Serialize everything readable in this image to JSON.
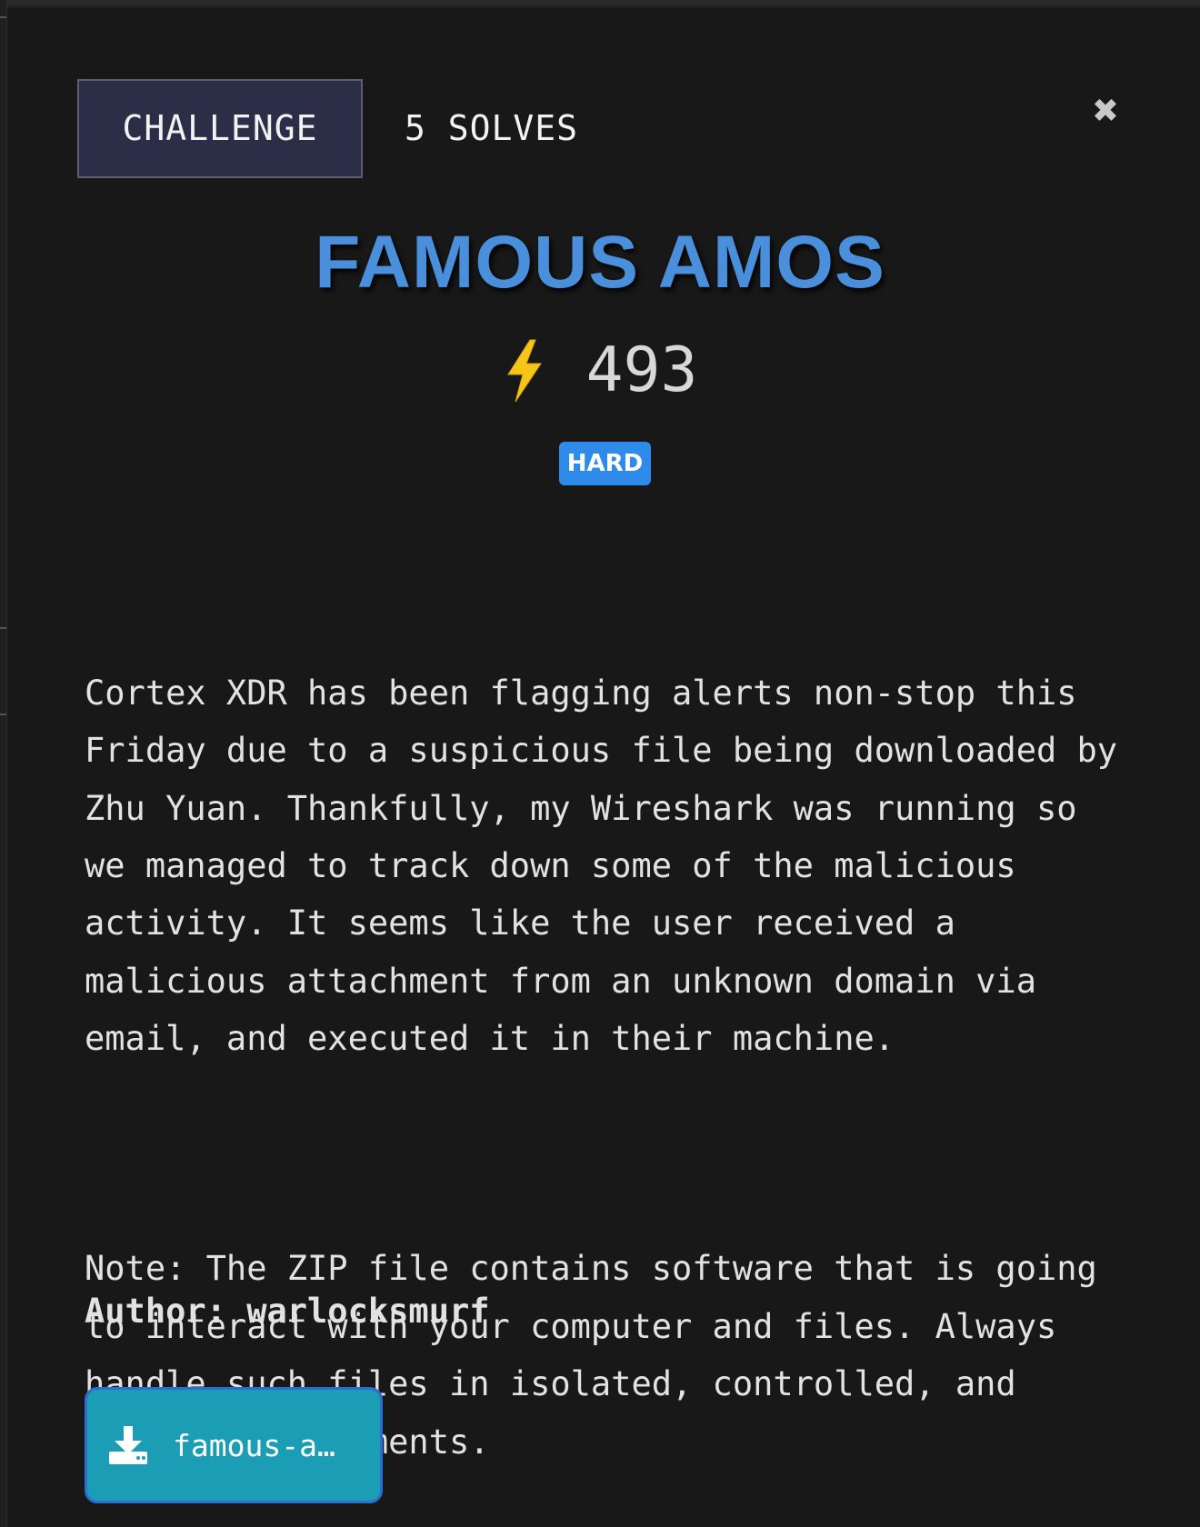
{
  "header": {
    "tab_challenge": "CHALLENGE",
    "tab_solves": "5 SOLVES",
    "close_label": "✖"
  },
  "challenge": {
    "title": "FAMOUS AMOS",
    "points": "493",
    "difficulty": "HARD",
    "description": "Cortex XDR has been flagging alerts non-stop this Friday due to a suspicious file being downloaded by Zhu Yuan. Thankfully, my Wireshark was running so we managed to track down some of the malicious activity. It seems like the user received a malicious attachment from an unknown domain via email, and executed it in their machine.",
    "note": "Note: The ZIP file contains software that is going to interact with your computer and files. Always handle such files in isolated, controlled, and secure environments.",
    "author_line": "Author: warlocksmurf"
  },
  "download": {
    "label": "famous-a…",
    "icon": "download-icon"
  },
  "icons": {
    "points": "lightning-bolt-icon",
    "close": "close-icon"
  },
  "colors": {
    "title": "#4a8fdc",
    "difficulty_badge": "#2e8bea",
    "download_button": "#1a9db5",
    "tab_challenge_bg": "#2c2e47",
    "bolt": "#f5c518"
  }
}
